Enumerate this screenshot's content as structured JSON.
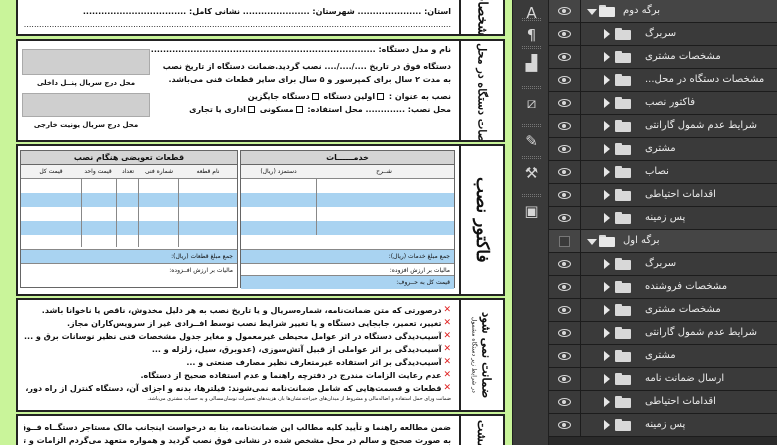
{
  "document": {
    "top_section": {
      "side_label": "مشخصات",
      "line1": "استان: ..................... شهرستان: ...................... نشانی کامل: ..................................",
      "line2": "..........................................................................................................................................................................."
    },
    "install_section": {
      "side_label": "مشخصات دستگاه در محل نصب",
      "line1": "نام و مدل دستگاه: .................................................................................................",
      "line2": "دستگاه فوق در تاریخ ..../..../.... نصب گردید.ضمانت دستگاه از تاریخ نصب",
      "line3": "به مدت ۲ سال برای کمپرسور و ۵ سال برای سایر قطعات فنی می‌باشد.",
      "line4_prefix": "نصب به عنوان :",
      "opt_first": "اولین دستگاه",
      "opt_replace": "دستگاه جایگزین",
      "usage_label": "محل استفاده:",
      "opt_residential": "مسکونی",
      "opt_office": "اداری یا تجاری",
      "install_place": "محل نصب: .............",
      "indoor_serial_caption": "محل درج سریال پنــل داخلی",
      "outdoor_serial_caption": "محل درج سریال یونیت خارجی"
    },
    "invoice_section": {
      "side_label": "فاکتور نصب",
      "parts_header": "قطعات تعویضی هنگام نصب",
      "services_header": "خدمــــــات",
      "col_part_no": "شماره فنی",
      "col_part_name": "نام قطعه",
      "col_qty": "تعداد",
      "col_unit_price": "قیمت واحد",
      "col_total_price": "قیمت کل",
      "col_description": "شــرح",
      "col_wage": "دستمزد (ریال)",
      "sum_parts": "جمع مبلغ قطعات (ریال):",
      "vat_parts": "مالیات بر ارزش افــزوده:",
      "sum_services": "جمع مبلغ خدمات (ریال):",
      "vat_services": "مالیات بر ارزش افزوده:",
      "total_words": "قیمت کل به حــروف:"
    },
    "warranty_section": {
      "side_label": "ضمانت نمی شود",
      "side_sub": "در شرایط زیر دستگاه مشمول",
      "items": [
        "درصورتی که متن ضمانت‌نامه، شماره‌سریال و یا تاریخ نصب به هر دلیل مخدوش، ناقص یا ناخوانا باشد.",
        "تغییر، تعمیر، جابجایی دستگاه و یا تغییر شرایط نصب توسط افــرادی غیر از سرویس‌کاران مجاز.",
        "آسیب‌دیدگی دستگاه در اثر عوامل محیطی غیرمعمول و مغایر جدول مشخصات فنی نظیر نوسانات برق و ...",
        "آسیب‌دیدگی بر اثر عواملی از قبیل آتش‌سوزی، (عدوبرق، سیل، زلزله و ...",
        "آسیب‌دیدگی بر اثر استفاده غیرمتعارف نظیر مصارف صنعتی و ...",
        "عدم رعایت الزامات مندرج در دفترچه راهنما و عدم استفاده صحیح از دستگاه.",
        "قطعات و قسمت‌هایی که شامل ضمانت‌نامه نمی‌شوند: فیلترها، بدنه و اجزای آن، دستگاه کنترل از راه دور، وسایل و تجهیزات جانبی."
      ],
      "footnote": "ضمانت ورای حمل استفاده و اضاله‌مالی و مشروط از میدان‌های خیراخته‌نشان‌ها باز، هزینه‌های تعمیرات نوسان‌مسالی و به حساب مشتری می‌باشد."
    },
    "bottom_section": {
      "side_label": "مشت",
      "line1": "ضمن مطالعه راهنما و تأیید کلیه مطالب این ضمانت‌نامه، بنا به درخواست اینجانب مالک   مستاجر   دستگــاه فــوق‌الـذکر",
      "line2": "به صورت صحیح و سالم در محل مشخص شده در نشانی فوق نصب گردید و همواره متعهد می‌گردم الزامات و توصیه های ایمنی"
    }
  },
  "tools": [
    {
      "name": "character-panel-icon",
      "glyph": "A"
    },
    {
      "name": "paragraph-panel-icon",
      "glyph": "¶"
    },
    {
      "name": "histogram-icon",
      "glyph": "▟"
    },
    {
      "name": "adjustments-icon",
      "glyph": "⧄"
    },
    {
      "name": "brush-presets-icon",
      "glyph": "✎"
    },
    {
      "name": "tool-presets-icon",
      "glyph": "⚒"
    },
    {
      "name": "layer-comps-icon",
      "glyph": "▣"
    }
  ],
  "layers": [
    {
      "name": "برگه دوم",
      "type": "group-open",
      "visible": true
    },
    {
      "name": "سربرگ",
      "type": "group",
      "visible": true
    },
    {
      "name": "مشخصات مشتری",
      "type": "group",
      "visible": true
    },
    {
      "name": "مشخصات دستگاه در محل...",
      "type": "group",
      "visible": true
    },
    {
      "name": "فاکتور نصب",
      "type": "group",
      "visible": true
    },
    {
      "name": "شرایط عدم شمول گارانتی",
      "type": "group",
      "visible": true
    },
    {
      "name": "مشتری",
      "type": "group",
      "visible": true
    },
    {
      "name": "نصاب",
      "type": "group",
      "visible": true
    },
    {
      "name": "اقدامات احتیاطی",
      "type": "group",
      "visible": true
    },
    {
      "name": "پس زمینه",
      "type": "group",
      "visible": true
    },
    {
      "name": "برگه اول",
      "type": "group-open",
      "visible": false
    },
    {
      "name": "سربرگ",
      "type": "group",
      "visible": true
    },
    {
      "name": "مشخصات فروشنده",
      "type": "group",
      "visible": true
    },
    {
      "name": "مشخصات مشتری",
      "type": "group",
      "visible": true
    },
    {
      "name": "شرایط عدم شمول گارانتی",
      "type": "group",
      "visible": true
    },
    {
      "name": "مشتری",
      "type": "group",
      "visible": true
    },
    {
      "name": "ارسال ضمانت نامه",
      "type": "group",
      "visible": true
    },
    {
      "name": "اقدامات احتیاطی",
      "type": "group",
      "visible": true
    },
    {
      "name": "پس زمینه",
      "type": "group",
      "visible": true
    }
  ],
  "colors": {
    "canvas_bg": "#c9f49a",
    "table_blue": "#a9d3f1",
    "panel_bg": "#3a3a3a",
    "warn_x": "#e02020"
  }
}
